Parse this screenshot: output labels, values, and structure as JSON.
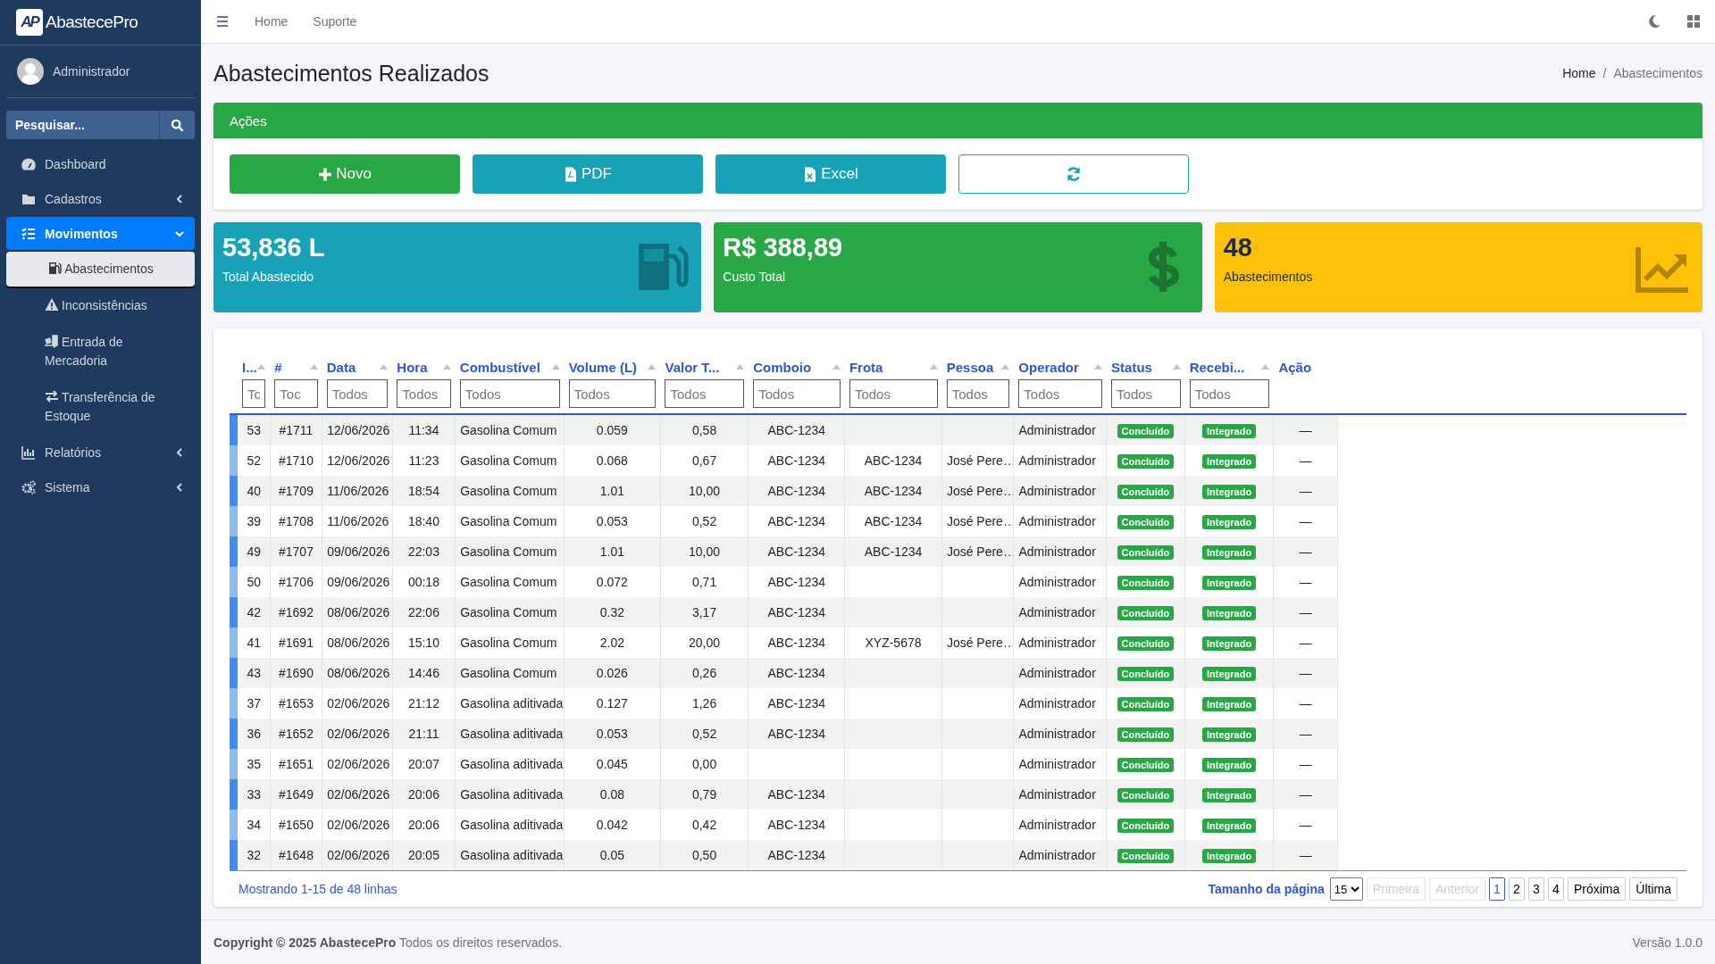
{
  "brand": {
    "mark": "AP",
    "name": "AbastecePro"
  },
  "user": {
    "name": "Administrador"
  },
  "sidebar": {
    "search": {
      "placeholder": "Pesquisar..."
    },
    "items": [
      {
        "label": "Dashboard",
        "kind": "link",
        "selected": false
      },
      {
        "label": "Cadastros",
        "kind": "group",
        "selected": false,
        "expanded": false
      },
      {
        "label": "Movimentos",
        "kind": "group",
        "selected": true,
        "expanded": true,
        "children": [
          {
            "label": "Abastecimentos",
            "selected": true
          },
          {
            "label": "Inconsistências",
            "selected": false
          },
          {
            "label": "Entrada de Mercadoria",
            "selected": false
          },
          {
            "label": "Transferência de Estoque",
            "selected": false
          }
        ]
      },
      {
        "label": "Relatórios",
        "kind": "group",
        "selected": false,
        "expanded": false
      },
      {
        "label": "Sistema",
        "kind": "group",
        "selected": false,
        "expanded": false
      }
    ]
  },
  "topbar": {
    "links": [
      "Home",
      "Suporte"
    ]
  },
  "page": {
    "title": "Abastecimentos Realizados",
    "breadcrumb": {
      "items": [
        "Home",
        "Abastecimentos"
      ],
      "separator": "/"
    }
  },
  "actions": {
    "title": "Ações",
    "buttons": [
      {
        "label": "Novo",
        "kind": "new"
      },
      {
        "label": "PDF",
        "kind": "pdf"
      },
      {
        "label": "Excel",
        "kind": "excel"
      },
      {
        "kind": "refresh"
      }
    ]
  },
  "stats": [
    {
      "value": "53,836 L",
      "label": "Total Abastecido",
      "color": "#17a2b8",
      "kind": "fuel"
    },
    {
      "value": "R$ 388,89",
      "label": "Custo Total",
      "color": "#28a745",
      "kind": "money"
    },
    {
      "value": "48",
      "label": "Abastecimentos",
      "color": "#ffc107",
      "kind": "chart"
    }
  ],
  "table": {
    "columns": [
      {
        "label": "I...",
        "kind": "center",
        "sortable": true,
        "placeholder": "Tc"
      },
      {
        "label": "#",
        "kind": "center",
        "sortable": true,
        "placeholder": "Toc"
      },
      {
        "label": "Data",
        "kind": "center",
        "sortable": true,
        "placeholder": "Todos"
      },
      {
        "label": "Hora",
        "kind": "center",
        "sortable": true,
        "placeholder": "Todos"
      },
      {
        "label": "Combustível",
        "kind": "left",
        "sortable": true,
        "placeholder": "Todos"
      },
      {
        "label": "Volume (L)",
        "kind": "center",
        "sortable": true,
        "placeholder": "Todos"
      },
      {
        "label": "Valor T...",
        "kind": "center",
        "sortable": true,
        "placeholder": "Todos"
      },
      {
        "label": "Comboio",
        "kind": "center",
        "sortable": true,
        "placeholder": "Todos"
      },
      {
        "label": "Frota",
        "kind": "center",
        "sortable": true,
        "placeholder": "Todos"
      },
      {
        "label": "Pessoa",
        "kind": "left",
        "sortable": true,
        "placeholder": "Todos"
      },
      {
        "label": "Operador",
        "kind": "left",
        "sortable": true,
        "placeholder": "Todos"
      },
      {
        "label": "Status",
        "kind": "badge",
        "sortable": true,
        "placeholder": "Todos"
      },
      {
        "label": "Recebi...",
        "kind": "badge",
        "sortable": true,
        "placeholder": "Todos"
      },
      {
        "label": "Ação",
        "kind": "center",
        "sortable": false
      }
    ],
    "rows": [
      {
        "cells": [
          "53",
          "#1711",
          "12/06/2026",
          "11:34",
          "Gasolina Comum",
          "0.059",
          "0,58",
          "ABC-1234",
          null,
          null,
          "Administrador",
          "Concluído",
          "Integrado",
          "—"
        ]
      },
      {
        "cells": [
          "52",
          "#1710",
          "12/06/2026",
          "11:23",
          "Gasolina Comum",
          "0.068",
          "0,67",
          "ABC-1234",
          "ABC-1234",
          "José Pere…",
          "Administrador",
          "Concluído",
          "Integrado",
          "—"
        ]
      },
      {
        "cells": [
          "40",
          "#1709",
          "11/06/2026",
          "18:54",
          "Gasolina Comum",
          "1.01",
          "10,00",
          "ABC-1234",
          "ABC-1234",
          "José Pere…",
          "Administrador",
          "Concluído",
          "Integrado",
          "—"
        ]
      },
      {
        "cells": [
          "39",
          "#1708",
          "11/06/2026",
          "18:40",
          "Gasolina Comum",
          "0.053",
          "0,52",
          "ABC-1234",
          "ABC-1234",
          "José Pere…",
          "Administrador",
          "Concluído",
          "Integrado",
          "—"
        ]
      },
      {
        "cells": [
          "49",
          "#1707",
          "09/06/2026",
          "22:03",
          "Gasolina Comum",
          "1.01",
          "10,00",
          "ABC-1234",
          "ABC-1234",
          "José Pere…",
          "Administrador",
          "Concluído",
          "Integrado",
          "—"
        ]
      },
      {
        "cells": [
          "50",
          "#1706",
          "09/06/2026",
          "00:18",
          "Gasolina Comum",
          "0.072",
          "0,71",
          "ABC-1234",
          null,
          null,
          "Administrador",
          "Concluído",
          "Integrado",
          "—"
        ]
      },
      {
        "cells": [
          "42",
          "#1692",
          "08/06/2026",
          "22:06",
          "Gasolina Comum",
          "0.32",
          "3,17",
          "ABC-1234",
          null,
          null,
          "Administrador",
          "Concluído",
          "Integrado",
          "—"
        ]
      },
      {
        "cells": [
          "41",
          "#1691",
          "08/06/2026",
          "15:10",
          "Gasolina Comum",
          "2.02",
          "20,00",
          "ABC-1234",
          "XYZ-5678",
          "José Pere…",
          "Administrador",
          "Concluído",
          "Integrado",
          "—"
        ]
      },
      {
        "cells": [
          "43",
          "#1690",
          "08/06/2026",
          "14:46",
          "Gasolina Comum",
          "0.026",
          "0,26",
          "ABC-1234",
          null,
          null,
          "Administrador",
          "Concluído",
          "Integrado",
          "—"
        ]
      },
      {
        "cells": [
          "37",
          "#1653",
          "02/06/2026",
          "21:12",
          "Gasolina aditivada",
          "0.127",
          "1,26",
          "ABC-1234",
          null,
          null,
          "Administrador",
          "Concluído",
          "Integrado",
          "—"
        ]
      },
      {
        "cells": [
          "36",
          "#1652",
          "02/06/2026",
          "21:11",
          "Gasolina aditivada",
          "0.053",
          "0,52",
          "ABC-1234",
          null,
          null,
          "Administrador",
          "Concluído",
          "Integrado",
          "—"
        ]
      },
      {
        "cells": [
          "35",
          "#1651",
          "02/06/2026",
          "20:07",
          "Gasolina aditivada",
          "0.045",
          "0,00",
          null,
          null,
          null,
          "Administrador",
          "Concluído",
          "Integrado",
          "—"
        ]
      },
      {
        "cells": [
          "33",
          "#1649",
          "02/06/2026",
          "20:06",
          "Gasolina aditivada",
          "0.08",
          "0,79",
          "ABC-1234",
          null,
          null,
          "Administrador",
          "Concluído",
          "Integrado",
          "—"
        ]
      },
      {
        "cells": [
          "34",
          "#1650",
          "02/06/2026",
          "20:06",
          "Gasolina aditivada",
          "0.042",
          "0,42",
          "ABC-1234",
          null,
          null,
          "Administrador",
          "Concluído",
          "Integrado",
          "—"
        ]
      },
      {
        "cells": [
          "32",
          "#1648",
          "02/06/2026",
          "20:05",
          "Gasolina aditivada",
          "0.05",
          "0,50",
          "ABC-1234",
          null,
          null,
          "Administrador",
          "Concluído",
          "Integrado",
          "—"
        ]
      }
    ]
  },
  "pagination": {
    "summary": "Mostrando 1-15 de 48 linhas",
    "page_size_label": "Tamanho da página",
    "page_size": "15",
    "buttons": [
      {
        "label": "Primeira",
        "kind": "nav",
        "disabled": true,
        "selected": false
      },
      {
        "label": "Anterior",
        "kind": "nav",
        "disabled": true,
        "selected": false
      },
      {
        "label": "1",
        "kind": "page",
        "disabled": false,
        "selected": true
      },
      {
        "label": "2",
        "kind": "page",
        "disabled": false,
        "selected": false
      },
      {
        "label": "3",
        "kind": "page",
        "disabled": false,
        "selected": false
      },
      {
        "label": "4",
        "kind": "page",
        "disabled": false,
        "selected": false
      },
      {
        "label": "Próxima",
        "kind": "nav",
        "disabled": false,
        "selected": false
      },
      {
        "label": "Última",
        "kind": "nav",
        "disabled": false,
        "selected": false
      }
    ]
  },
  "footer": {
    "copyright": "**Copyright © 2025 AbastecePro** Todos os direitos reservados.",
    "version": "Versão 1.0.0"
  }
}
